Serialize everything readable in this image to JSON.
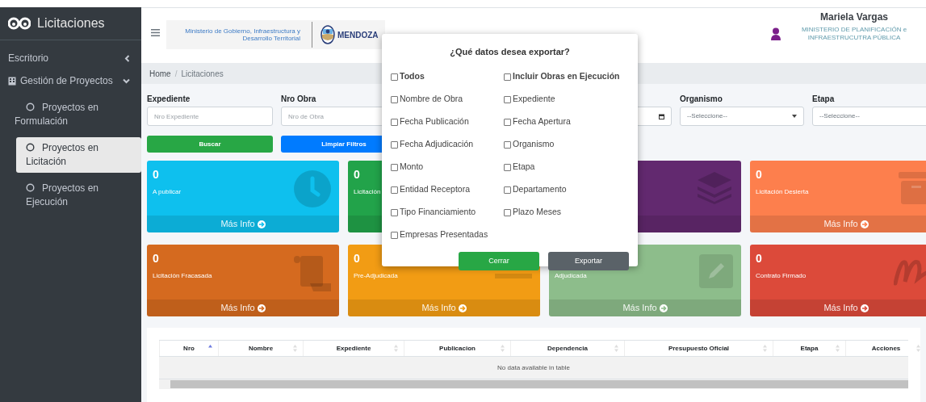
{
  "sidebar": {
    "brand": "Licitaciones",
    "items": [
      {
        "label": "Escritorio",
        "expanded": false
      },
      {
        "label": "Gestión de Proyectos",
        "expanded": true,
        "children": [
          {
            "label": "Proyectos en Formulación",
            "selected": false
          },
          {
            "label": "Proyectos en Licitación",
            "selected": true
          },
          {
            "label": "Proyectos en Ejecución",
            "selected": false
          }
        ]
      }
    ]
  },
  "header": {
    "ministry": "Ministerio de Gobierno, Infraestructura y Desarrollo Territorial",
    "province": "MENDOZA",
    "user": {
      "name": "Mariela Vargas",
      "org": "MINISTERIO DE PLANIFICACIÓN e INFRAESTRUCUTRA PÚBLICA"
    }
  },
  "breadcrumb": {
    "items": [
      "Home",
      "Licitaciones"
    ],
    "separator": "/"
  },
  "filters": [
    {
      "kind": "text",
      "label": "Expediente",
      "placeholder": "Nro Expediente"
    },
    {
      "kind": "text",
      "label": "Nro Obra",
      "placeholder": "Nro de Obra"
    },
    {
      "kind": "date"
    },
    {
      "kind": "select",
      "label": "Organismo",
      "value": "--Seleccione--"
    },
    {
      "kind": "select",
      "label": "Etapa",
      "value": "--Seleccione--"
    }
  ],
  "filter_buttons": [
    {
      "label": "Buscar",
      "color": "#28a745"
    },
    {
      "label": "Limpiar Filtros",
      "color": "#007bff"
    }
  ],
  "cards": [
    {
      "value": "0",
      "label": "A publicar",
      "footer": "Más Info",
      "color": "#0ec0ee"
    },
    {
      "value": "0",
      "label": "Licitación",
      "color": "#22a34a"
    },
    {
      "color": "#62296f"
    },
    {
      "value": "0",
      "label": "Licitación Desierta",
      "footer": "Más Info",
      "color": "#fd7f4d"
    },
    {
      "value": "0",
      "label": "Licitación Fracasada",
      "footer": "Más Info",
      "color": "#d56a1f"
    },
    {
      "value": "0",
      "label": "Pre-Adjudicada",
      "footer": "Más Info",
      "color": "#f29c14"
    },
    {
      "label": "Adjudicada",
      "footer": "Más Info",
      "color": "#8dbd8b"
    },
    {
      "value": "0",
      "label": "Contrato Firmado",
      "footer": "Más Info",
      "color": "#dc4a3a"
    }
  ],
  "table": {
    "columns": [
      {
        "label": "Nro",
        "sorted": true
      },
      {
        "label": "Nombre",
        "sorted": false
      },
      {
        "label": "Expediente",
        "sorted": false
      },
      {
        "label": "Publicacion",
        "sorted": false
      },
      {
        "label": "Dependencia",
        "sorted": false
      },
      {
        "label": "Presupuesto Oficial",
        "sorted": false
      },
      {
        "label": "Etapa",
        "sorted": false
      },
      {
        "label": "Acciones",
        "sorted": false
      }
    ],
    "empty": "No data available in table"
  },
  "dialog": {
    "title": "¿Qué datos desea exportar?",
    "options": [
      {
        "label": "Todos",
        "kind": "group",
        "checked": false
      },
      {
        "label": "Incluir Obras en Ejecución",
        "kind": "group",
        "checked": false
      },
      {
        "label": "Nombre de Obra",
        "kind": "field",
        "checked": false
      },
      {
        "label": "Expediente",
        "kind": "field",
        "checked": false
      },
      {
        "label": "Fecha Publicación",
        "kind": "field",
        "checked": false
      },
      {
        "label": "Fecha Apertura",
        "kind": "field",
        "checked": false
      },
      {
        "label": "Fecha Adjudicación",
        "kind": "field",
        "checked": false
      },
      {
        "label": "Organismo",
        "kind": "field",
        "checked": false
      },
      {
        "label": "Monto",
        "kind": "field",
        "checked": false
      },
      {
        "label": "Etapa",
        "kind": "field",
        "checked": false
      },
      {
        "label": "Entidad Receptora",
        "kind": "field",
        "checked": false
      },
      {
        "label": "Departamento",
        "kind": "field",
        "checked": false
      },
      {
        "label": "Tipo Financiamiento",
        "kind": "field",
        "checked": false
      },
      {
        "label": "Plazo Meses",
        "kind": "field",
        "checked": false
      },
      {
        "label": "Empresas Presentadas",
        "kind": "field",
        "checked": false
      }
    ],
    "buttons": [
      {
        "label": "Cerrar",
        "color": "#28a745"
      },
      {
        "label": "Exportar",
        "color": "#5a6268"
      }
    ]
  }
}
